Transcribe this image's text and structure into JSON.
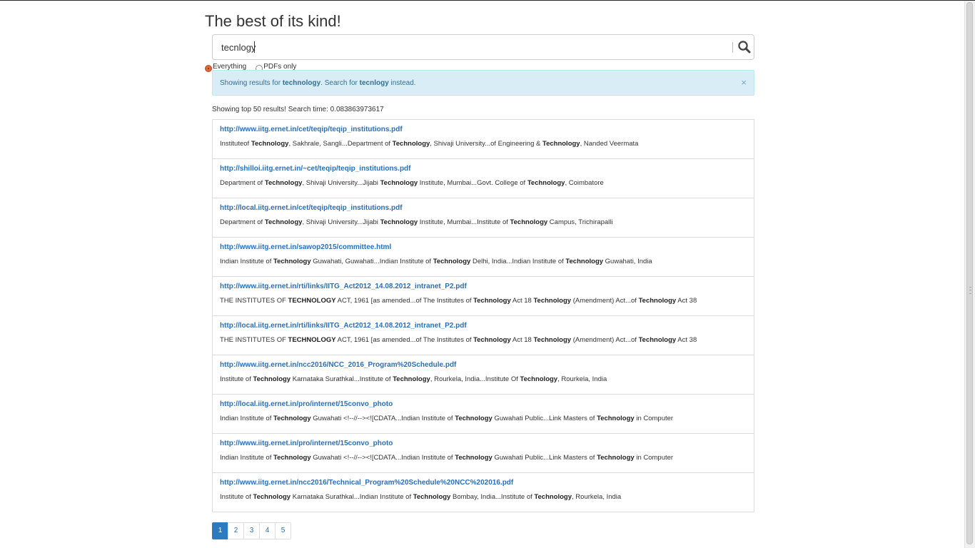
{
  "page_title": "The best of its kind!",
  "search": {
    "value": "tecnlogy",
    "button_icon": "search-icon"
  },
  "filters": [
    {
      "label": "Everything",
      "checked": true
    },
    {
      "label": "PDFs only",
      "checked": false
    }
  ],
  "alert": {
    "prefix": "Showing results for ",
    "corrected": "technology",
    "middle": ". Search for ",
    "original": "tecnlogy",
    "suffix": " instead.",
    "close": "×"
  },
  "result_meta": "Showing top 50 results! Search time: 0.083863973617",
  "results": [
    {
      "url": "http://www.iitg.ernet.in/cet/teqip/teqip_institutions.pdf",
      "snippet": "Instituteof <b>Technology</b>, Sakhrale, Sangli...Department of <b>Technology</b>, Shivaji University...of Engineering &amp; <b>Technology</b>, Nanded Veermata"
    },
    {
      "url": "http://shilloi.iitg.ernet.in/~cet/teqip/teqip_institutions.pdf",
      "snippet": "Department of <b>Technology</b>, Shivaji University...Jijabi <b>Technology</b> Institute, Mumbai...Govt. College of <b>Technology</b>, Coimbatore"
    },
    {
      "url": "http://local.iitg.ernet.in/cet/teqip/teqip_institutions.pdf",
      "snippet": "Department of <b>Technology</b>, Shivaji University...Jijabi <b>Technology</b> Institute, Mumbai...Institute of <b>Technology</b> Campus, Trichirapalli"
    },
    {
      "url": "http://www.iitg.ernet.in/sawop2015/committee.html",
      "snippet": "Indian Institute of <b>Technology</b> Guwahati, Guwahati...Indian Institute of <b>Technology</b> Delhi, India...Indian Institute of <b>Technology</b> Guwahati, India"
    },
    {
      "url": "http://www.iitg.ernet.in/rti/links/IITG_Act2012_14.08.2012_intranet_P2.pdf",
      "snippet": "THE INSTITUTES OF <b>TECHNOLOGY</b> ACT, 1961 [as amended...of The Institutes of <b>Technology</b> Act 18 <b>Technology</b> (Amendment) Act...of <b>Technology</b> Act 38"
    },
    {
      "url": "http://local.iitg.ernet.in/rti/links/IITG_Act2012_14.08.2012_intranet_P2.pdf",
      "snippet": "THE INSTITUTES OF <b>TECHNOLOGY</b> ACT, 1961 [as amended...of The Institutes of <b>Technology</b> Act 18 <b>Technology</b> (Amendment) Act...of <b>Technology</b> Act 38"
    },
    {
      "url": "http://www.iitg.ernet.in/ncc2016/NCC_2016_Program%20Schedule.pdf",
      "snippet": "Institute of <b>Technology</b> Karnataka Surathkal...Institute of <b>Technology</b>, Rourkela, India...Institute Of <b>Technology</b>, Rourkela, India"
    },
    {
      "url": "http://local.iitg.ernet.in/pro/internet/15convo_photo",
      "snippet": "Indian Institute of <b>Technology</b> Guwahati &lt;!--//--&gt;&lt;![CDATA...Indian Institute of <b>Technology</b> Guwahati Public...Link Masters of <b>Technology</b> in Computer"
    },
    {
      "url": "http://www.iitg.ernet.in/pro/internet/15convo_photo",
      "snippet": "Indian Institute of <b>Technology</b> Guwahati &lt;!--//--&gt;&lt;![CDATA...Indian Institute of <b>Technology</b> Guwahati Public...Link Masters of <b>Technology</b> in Computer"
    },
    {
      "url": "http://www.iitg.ernet.in/ncc2016/Technical_Program%20Schedule%20NCC%202016.pdf",
      "snippet": "Institute of <b>Technology</b> Karnataka Surathkal...Indian Institute of <b>Technology</b> Bombay, India...Institute of <b>Technology</b>, Rourkela, India"
    }
  ],
  "pagination": {
    "pages": [
      "1",
      "2",
      "3",
      "4",
      "5"
    ],
    "active": "1"
  },
  "colors": {
    "link": "#2a6fb5",
    "alert_bg": "#d9edf7",
    "active_page": "#2c7ac0",
    "radio_checked": "#e0693a"
  }
}
